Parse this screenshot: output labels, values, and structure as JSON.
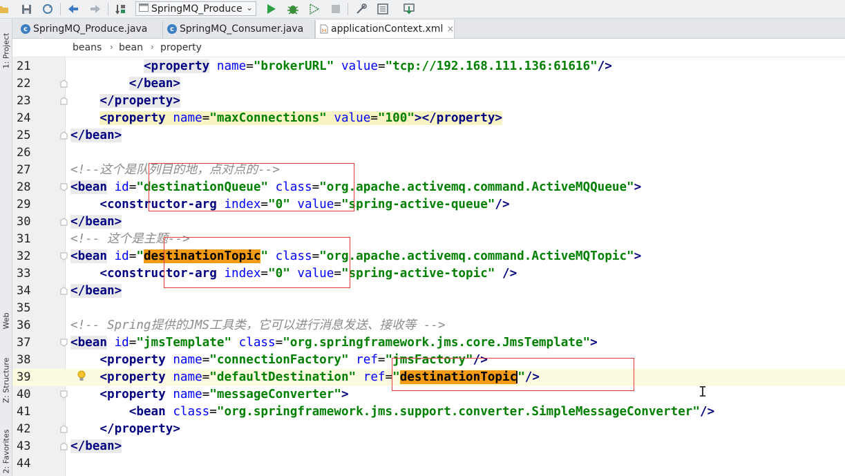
{
  "toolbar": {
    "run_config": "SpringMQ_Produce",
    "icons": [
      "folder-open-icon",
      "save-icon",
      "sync-icon",
      "back-icon",
      "forward-icon",
      "make-icon",
      "run-config-icon",
      "run-icon",
      "debug-icon",
      "coverage-icon",
      "stop-icon",
      "project-structure-icon",
      "sdk-manager-icon",
      "download-icon"
    ]
  },
  "left_strip": {
    "project": "1: Project",
    "web": "Web",
    "structure": "Z: Structure",
    "favorites": "2: Favorites"
  },
  "tabs": [
    {
      "label": "SpringMQ_Produce.java",
      "icon": "java-class-icon",
      "active": false
    },
    {
      "label": "SpringMQ_Consumer.java",
      "icon": "java-class-icon",
      "active": false
    },
    {
      "label": "applicationContext.xml",
      "icon": "xml-file-icon",
      "active": true,
      "close": "×"
    }
  ],
  "breadcrumb": [
    "beans",
    "bean",
    "property"
  ],
  "breadcrumb_separator": "›",
  "editor": {
    "current_line": "39",
    "lines": [
      {
        "n": "21"
      },
      {
        "n": "22"
      },
      {
        "n": "23"
      },
      {
        "n": "24"
      },
      {
        "n": "25"
      },
      {
        "n": "26"
      },
      {
        "n": "27"
      },
      {
        "n": "28"
      },
      {
        "n": "29"
      },
      {
        "n": "30"
      },
      {
        "n": "31"
      },
      {
        "n": "32"
      },
      {
        "n": "33"
      },
      {
        "n": "34"
      },
      {
        "n": "35"
      },
      {
        "n": "36"
      },
      {
        "n": "37"
      },
      {
        "n": "38"
      },
      {
        "n": "39"
      },
      {
        "n": "40"
      },
      {
        "n": "41"
      },
      {
        "n": "42"
      },
      {
        "n": "43"
      },
      {
        "n": "44"
      }
    ],
    "tokens": {
      "property": "property",
      "bean": "bean",
      "constructor_arg": "constructor-arg",
      "name": "name",
      "value": "value",
      "id": "id",
      "class": "class",
      "index": "index",
      "ref": "ref",
      "v_brokerURL": "\"brokerURL\"",
      "v_broker_value": "\"tcp://192.168.111.136:61616\"",
      "v_maxConnections": "\"maxConnections\"",
      "v_100": "\"100\"",
      "c27": "<!--这个是队列目的地，点对点的-->",
      "v_destinationQueue": "\"destinationQueue\"",
      "v_queue_class": "\"org.apache.activemq.command.ActiveMQQueue\"",
      "v_index0": "\"0\"",
      "v_queue_value": "\"spring-active-queue\"",
      "c31": "<!-- 这个是主题-->",
      "v_topic_id_word": "destinationTopic",
      "v_topic_class": "\"org.apache.activemq.command.ActiveMQTopic\"",
      "v_topic_value": "\"spring-active-topic\"",
      "c36": "<!-- Spring提供的JMS工具类，它可以进行消息发送、接收等 -->",
      "v_jmsTemplate": "\"jmsTemplate\"",
      "v_jms_class": "\"org.springframework.jms.core.JmsTemplate\"",
      "v_connectionFactory": "\"connectionFactory\"",
      "v_jmsFactory": "\"jmsFactory\"",
      "v_defaultDestination": "\"defaultDestination\"",
      "v_messageConverter": "\"messageConverter\"",
      "v_converter_class": "\"org.springframework.jms.support.converter.SimpleMessageConverter\""
    }
  },
  "colors": {
    "tag": "#000080",
    "attribute": "#0000ff",
    "value": "#008000",
    "comment": "#8c8c8c",
    "selection": "#f39b14",
    "annotation_box": "#e03a3a",
    "current_line": "#fcfadf"
  }
}
